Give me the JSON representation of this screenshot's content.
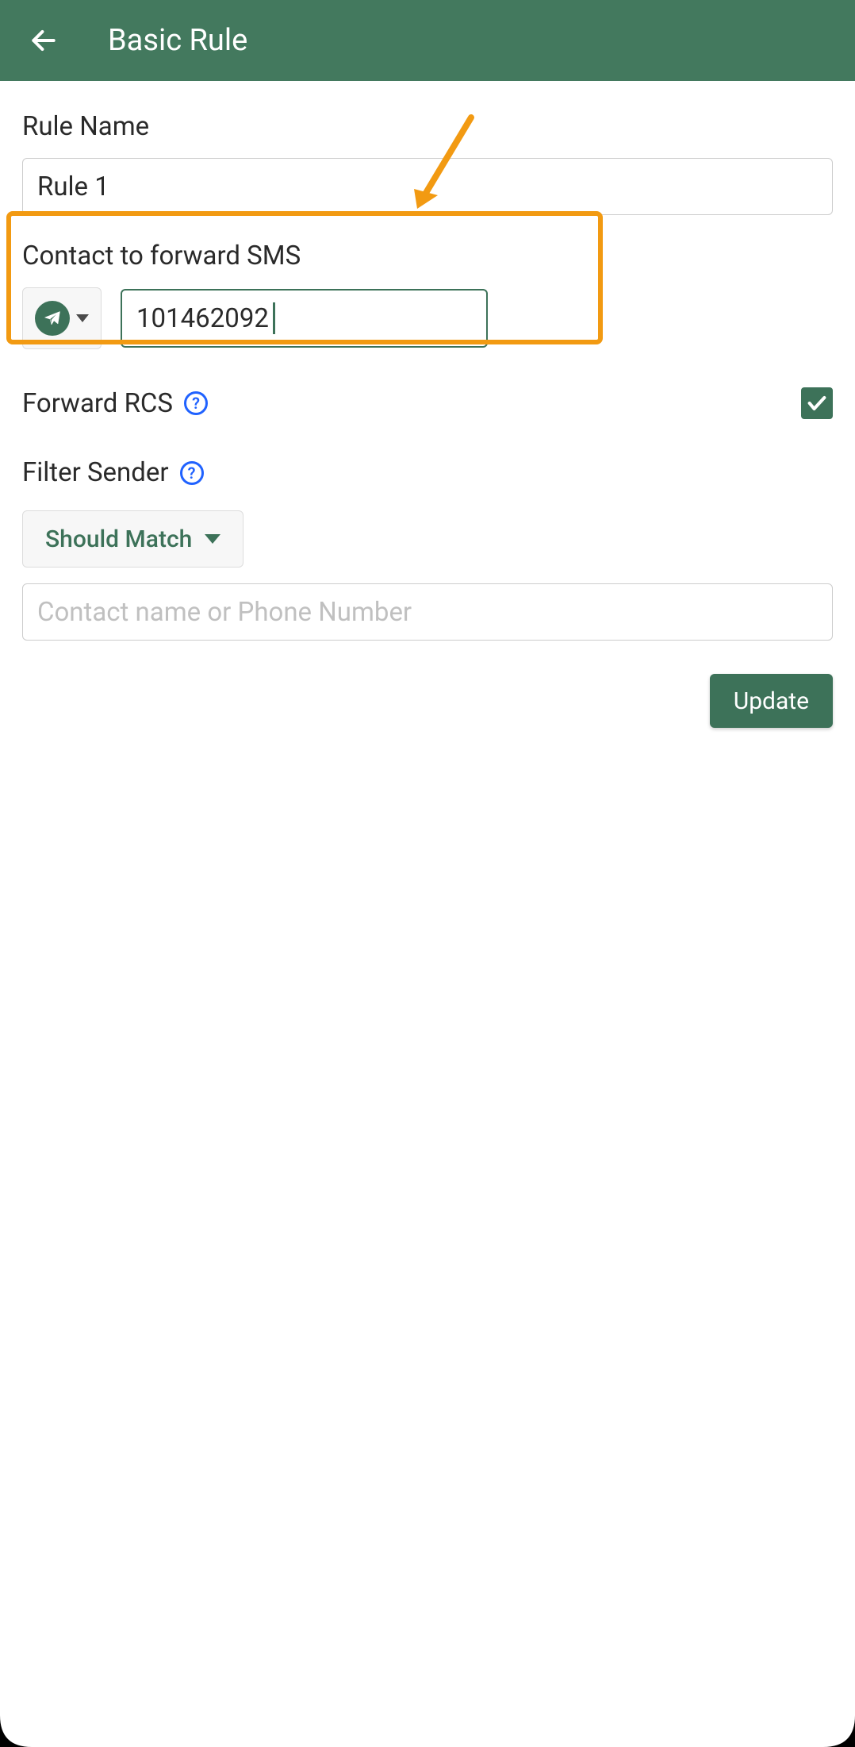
{
  "header": {
    "title": "Basic Rule"
  },
  "rule_name": {
    "label": "Rule Name",
    "value": "Rule 1"
  },
  "contact": {
    "label": "Contact to forward SMS",
    "value": "101462092"
  },
  "forward_rcs": {
    "label": "Forward RCS",
    "checked": true
  },
  "filter_sender": {
    "label": "Filter Sender",
    "dropdown": "Should Match",
    "placeholder": "Contact name or Phone Number",
    "value": ""
  },
  "update_button": "Update"
}
